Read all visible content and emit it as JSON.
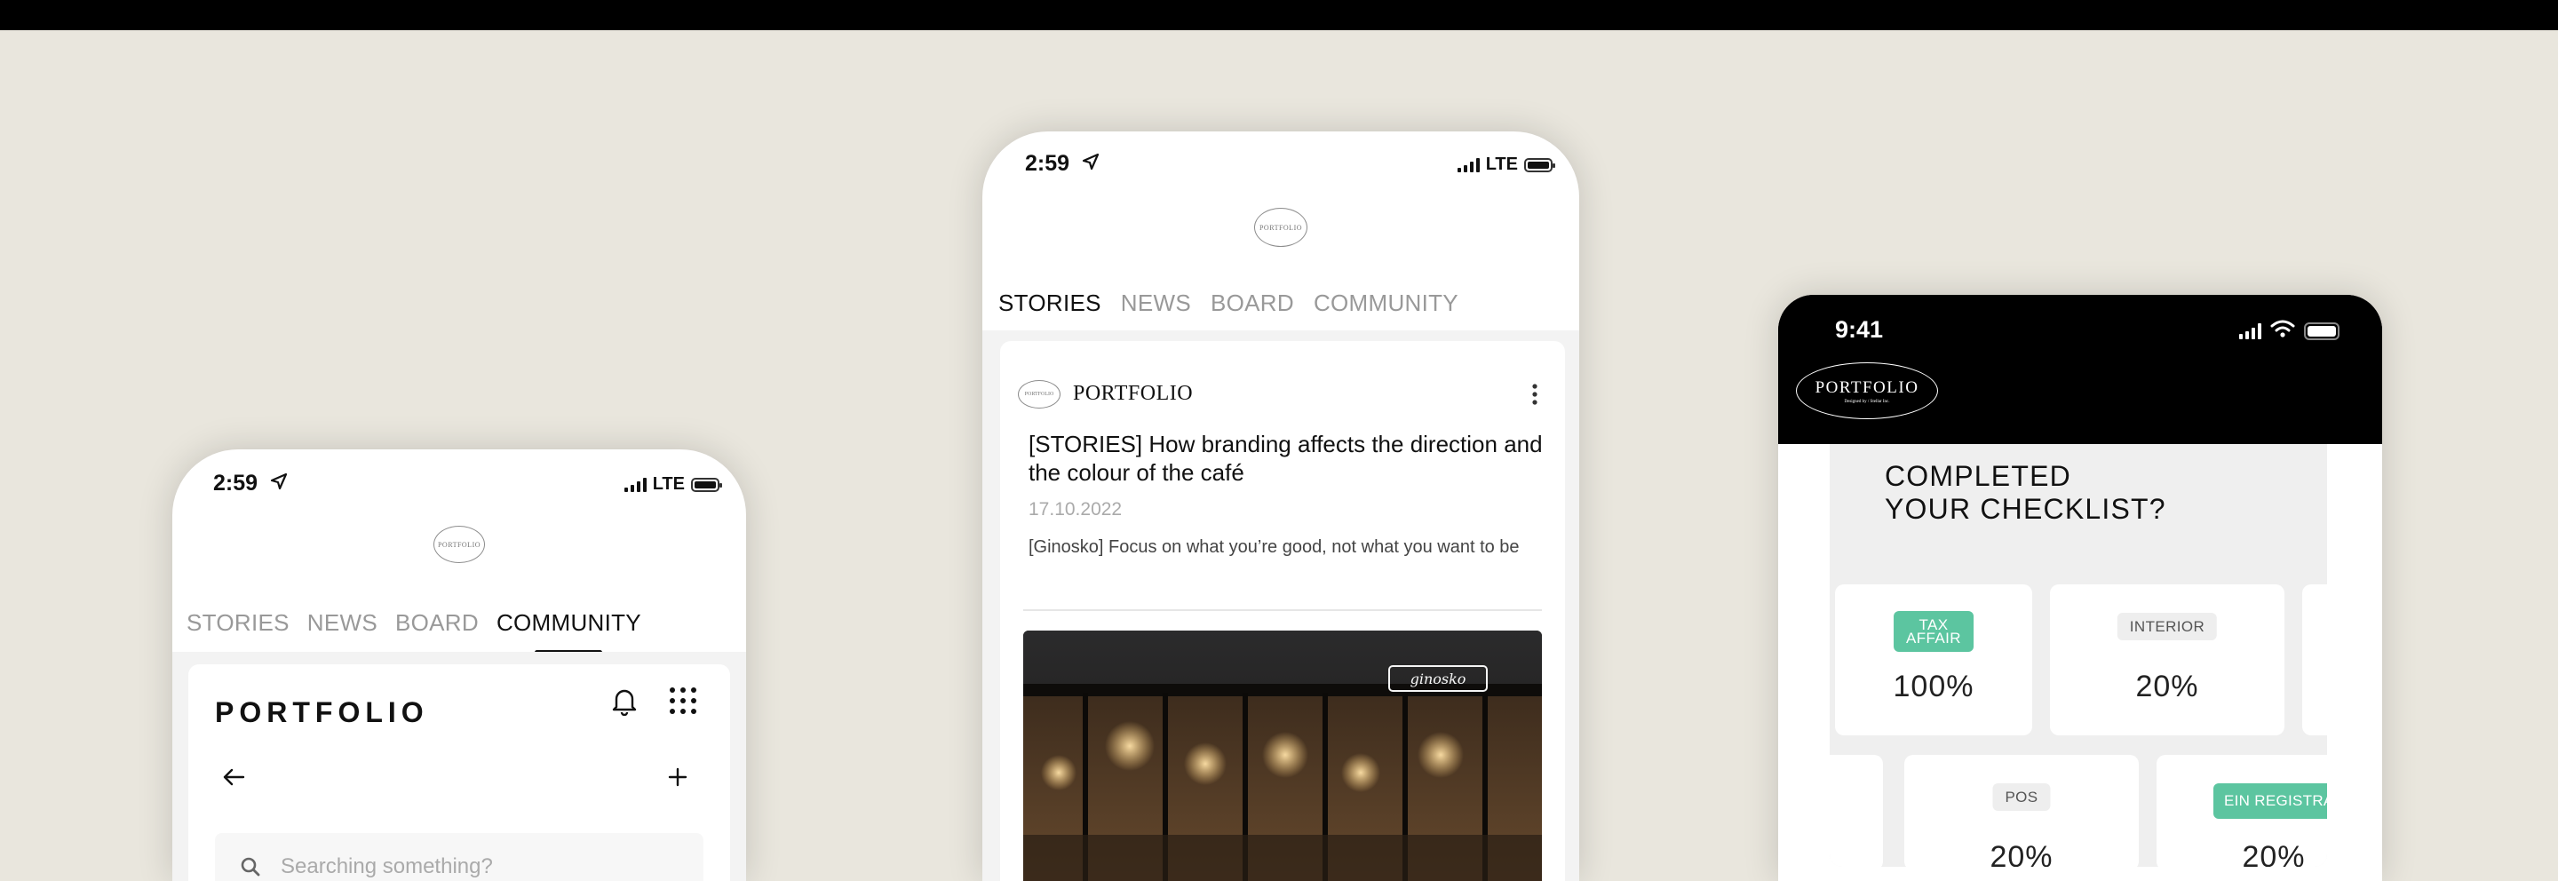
{
  "phone_left": {
    "status": {
      "time": "2:59",
      "network": "LTE"
    },
    "logo": {
      "text": "PORTFOLIO"
    },
    "tabs": [
      "STORIES",
      "NEWS",
      "BOARD",
      "COMMUNITY"
    ],
    "active_tab": "COMMUNITY",
    "community": {
      "brand": "PORTFOLIO",
      "search_placeholder": "Searching something?"
    }
  },
  "phone_center": {
    "status": {
      "time": "2:59",
      "network": "LTE"
    },
    "logo": {
      "text": "PORTFOLIO"
    },
    "tabs": [
      "STORIES",
      "NEWS",
      "BOARD",
      "COMMUNITY"
    ],
    "active_tab": "STORIES",
    "post": {
      "author": "PORTFOLIO",
      "title": "[STORIES] How branding affects the direction and the colour of the café",
      "date": "17.10.2022",
      "excerpt": "[Ginosko] Focus on what you’re good, not what you want to be",
      "image_sign": "ginosko"
    }
  },
  "phone_right": {
    "status": {
      "time": "9:41"
    },
    "logo": {
      "text": "PORTFOLIO",
      "subtext": "Designed by / Stellar Inc."
    },
    "heading": "COMPLETED YOUR CHECKLIST?",
    "heading_line1": "COMPLETED",
    "heading_line2": "YOUR CHECKLIST?",
    "items": [
      {
        "label": "TAX AFFAIR",
        "label_line1": "TAX",
        "label_line2": "AFFAIR",
        "percent": "100%",
        "style": "green"
      },
      {
        "label": "INTERIOR",
        "percent": "20%",
        "style": "grey"
      },
      {
        "label": "POS",
        "percent": "20%",
        "style": "grey"
      },
      {
        "label": "EIN REGISTRATION",
        "percent": "20%",
        "style": "green"
      }
    ],
    "accent_color": "#5cc5a0"
  }
}
